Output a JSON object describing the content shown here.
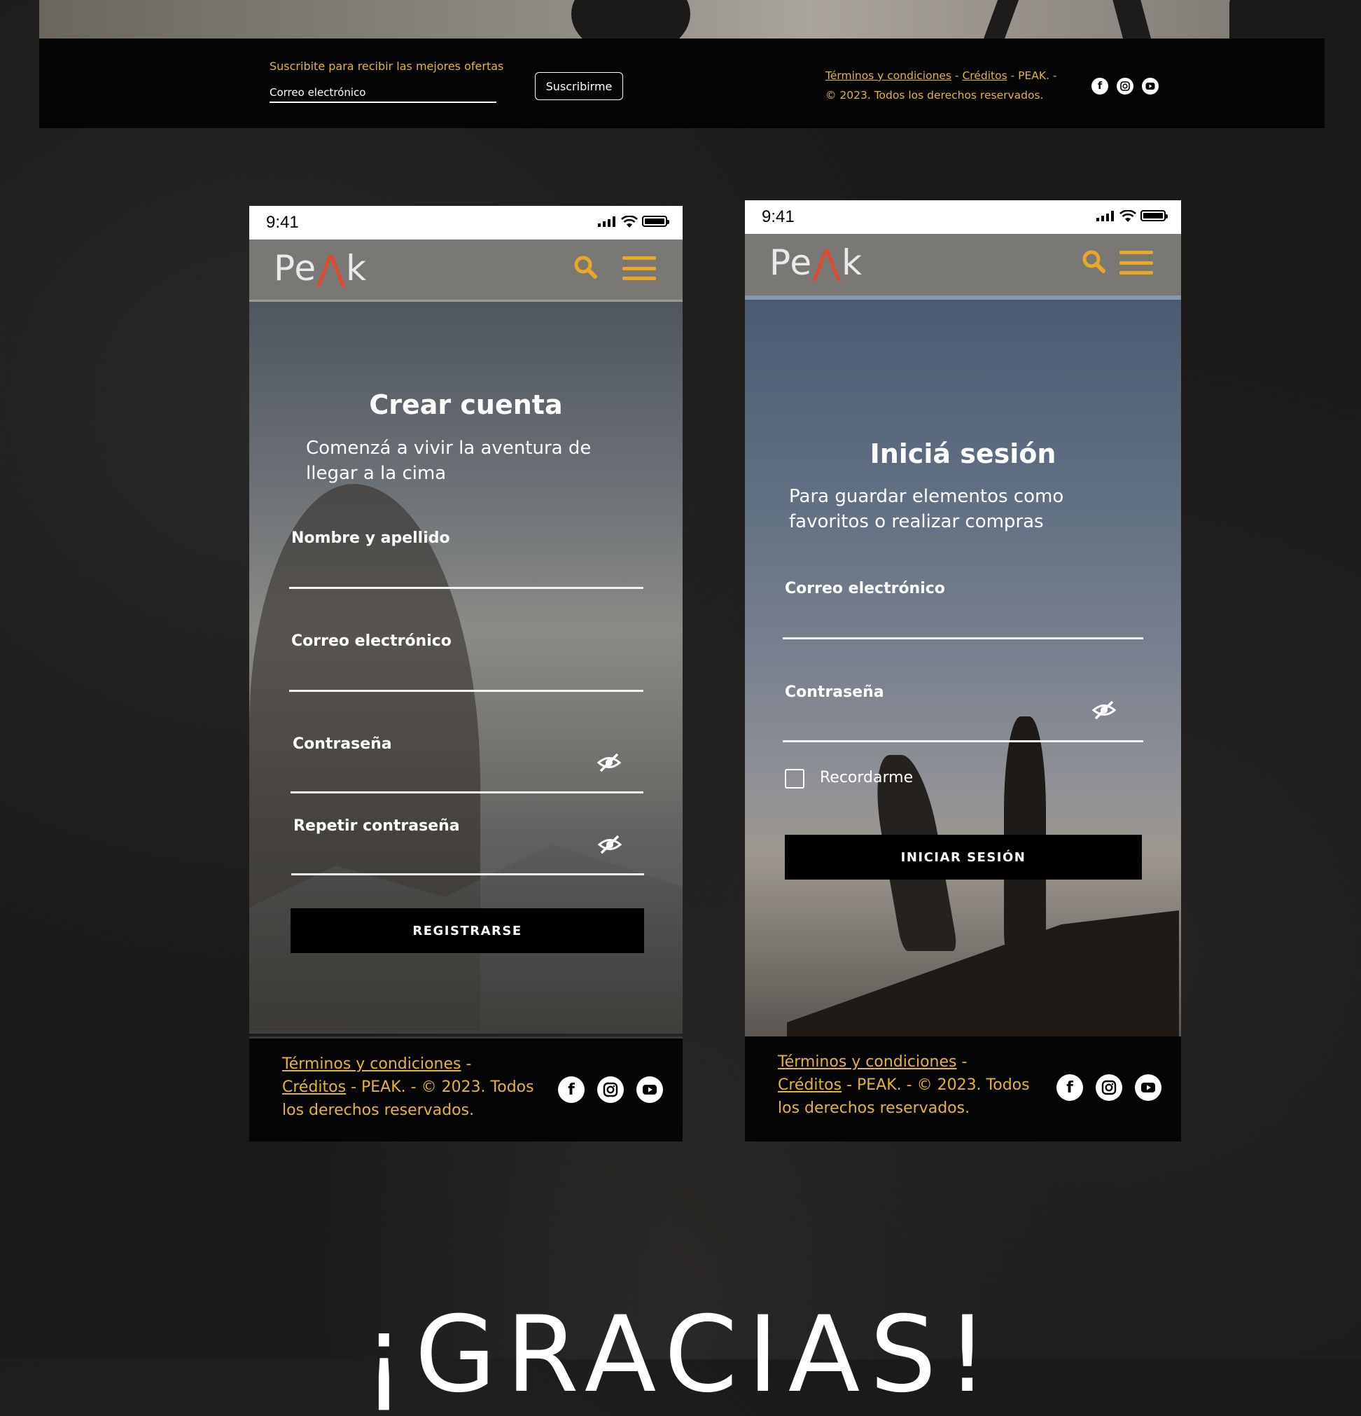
{
  "top_footer": {
    "subscribe_label": "Suscribite para recibir las mejores ofertas",
    "email_value": "Correo electrónico",
    "subscribe_button": "Suscribirme",
    "terms_link": "Términos y condiciones",
    "sep1": " - ",
    "credits_link": "Créditos",
    "legal_line1_tail": " - PEAK. -",
    "legal_line2": "© 2023. Todos los derechos reservados.",
    "social_icons": [
      "facebook-icon",
      "instagram-icon",
      "youtube-icon"
    ]
  },
  "phone_register": {
    "status_time": "9:41",
    "logo": {
      "a": "Pe",
      "b": "k"
    },
    "title": "Crear cuenta",
    "subtitle": "Comenzá a vivir la aventura de llegar a la cima",
    "fields": {
      "name": "Nombre y apellido",
      "email": "Correo electrónico",
      "password": "Contraseña",
      "repeat_password": "Repetir contraseña"
    },
    "submit": "REGISTRARSE",
    "footer": {
      "terms": "Términos y condiciones",
      "credits": "Créditos",
      "rest": " - PEAK. - © 2023. Todos los derechos reservados."
    }
  },
  "phone_login": {
    "status_time": "9:41",
    "logo": {
      "a": "Pe",
      "b": "k"
    },
    "title": "Iniciá sesión",
    "subtitle": "Para guardar elementos como favoritos o realizar compras",
    "fields": {
      "email": "Correo electrónico",
      "password": "Contraseña"
    },
    "remember": "Recordarme",
    "remember_checked": false,
    "submit": "INICIAR SESIÓN",
    "footer": {
      "terms": "Términos y condiciones",
      "credits": "Créditos",
      "rest": " - PEAK. - © 2023. Todos los derechos reservados."
    }
  },
  "closing": "¡GRACIAS!",
  "colors": {
    "accent_gold": "#e4b43a",
    "logo_triangle": "#e04a2a",
    "footer_bg": "#050505",
    "navbar_bg": "#7a7875"
  }
}
